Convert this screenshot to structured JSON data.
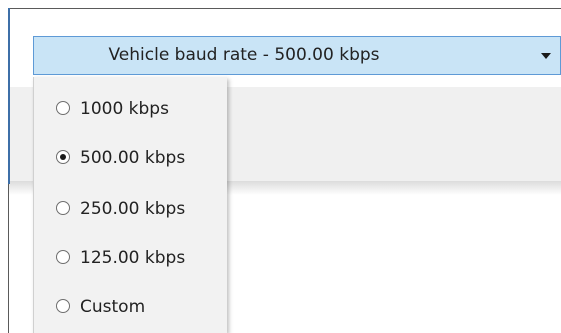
{
  "dropdown": {
    "label": "Vehicle baud rate - 500.00 kbps",
    "icon": "chevron-down-icon"
  },
  "menu": {
    "items": [
      {
        "label": "1000 kbps",
        "selected": false
      },
      {
        "label": "500.00 kbps",
        "selected": true
      },
      {
        "label": "250.00 kbps",
        "selected": false
      },
      {
        "label": "125.00 kbps",
        "selected": false
      },
      {
        "label": "Custom",
        "selected": false
      }
    ]
  },
  "colors": {
    "dropdown_background": "#c9e4f6",
    "dropdown_border": "#5e9ad6",
    "menu_background": "#f2f2f2"
  }
}
